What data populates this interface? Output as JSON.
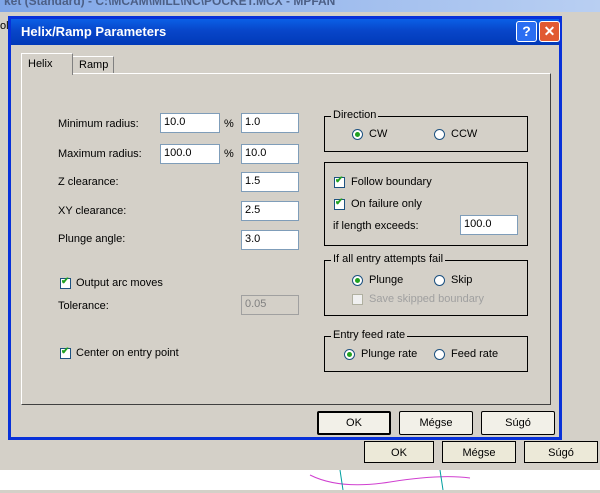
{
  "background_window": {
    "title": "ket (Standard) - C:\\MCAM\\MILL\\NC\\POCKET.MCX - MPFAN",
    "menu_fragment": "ol",
    "ok_label": "OK",
    "cancel_label": "Mégse",
    "help_label": "Súgó"
  },
  "dialog": {
    "title": "Helix/Ramp Parameters",
    "help_glyph": "?",
    "close_glyph": "✕",
    "tabs": [
      {
        "label": "Helix"
      },
      {
        "label": "Ramp"
      }
    ],
    "fields": {
      "min_radius": {
        "label": "Minimum radius:",
        "value": "10.0",
        "percent_value": "1.0"
      },
      "max_radius": {
        "label": "Maximum radius:",
        "value": "100.0",
        "percent_value": "10.0"
      },
      "percent_sign": "%",
      "z_clearance": {
        "label": "Z clearance:",
        "value": "1.5"
      },
      "xy_clearance": {
        "label": "XY clearance:",
        "value": "2.5"
      },
      "plunge_angle": {
        "label": "Plunge angle:",
        "value": "3.0"
      }
    },
    "output_arc_moves": {
      "label": "Output arc moves",
      "checked": true
    },
    "tolerance": {
      "label": "Tolerance:",
      "value": "0.05",
      "enabled": false
    },
    "center_on_entry": {
      "label": "Center on entry point",
      "checked": true
    },
    "direction": {
      "title": "Direction",
      "options": [
        {
          "label": "CW",
          "selected": true
        },
        {
          "label": "CCW",
          "selected": false
        }
      ]
    },
    "boundary": {
      "follow_boundary": {
        "label": "Follow boundary",
        "checked": true
      },
      "on_failure_only": {
        "label": "On failure only",
        "checked": true
      },
      "length_label": "if length exceeds:",
      "length_value": "100.0"
    },
    "entry_fail": {
      "title": "If all entry attempts fail",
      "options": [
        {
          "label": "Plunge",
          "selected": true
        },
        {
          "label": "Skip",
          "selected": false
        }
      ],
      "save_skipped": {
        "label": "Save skipped boundary",
        "checked": false,
        "enabled": false
      }
    },
    "feed_rate": {
      "title": "Entry feed rate",
      "options": [
        {
          "label": "Plunge rate",
          "selected": true
        },
        {
          "label": "Feed rate",
          "selected": false
        }
      ]
    },
    "buttons": {
      "ok": "OK",
      "cancel": "Mégse",
      "help": "Súgó"
    }
  }
}
